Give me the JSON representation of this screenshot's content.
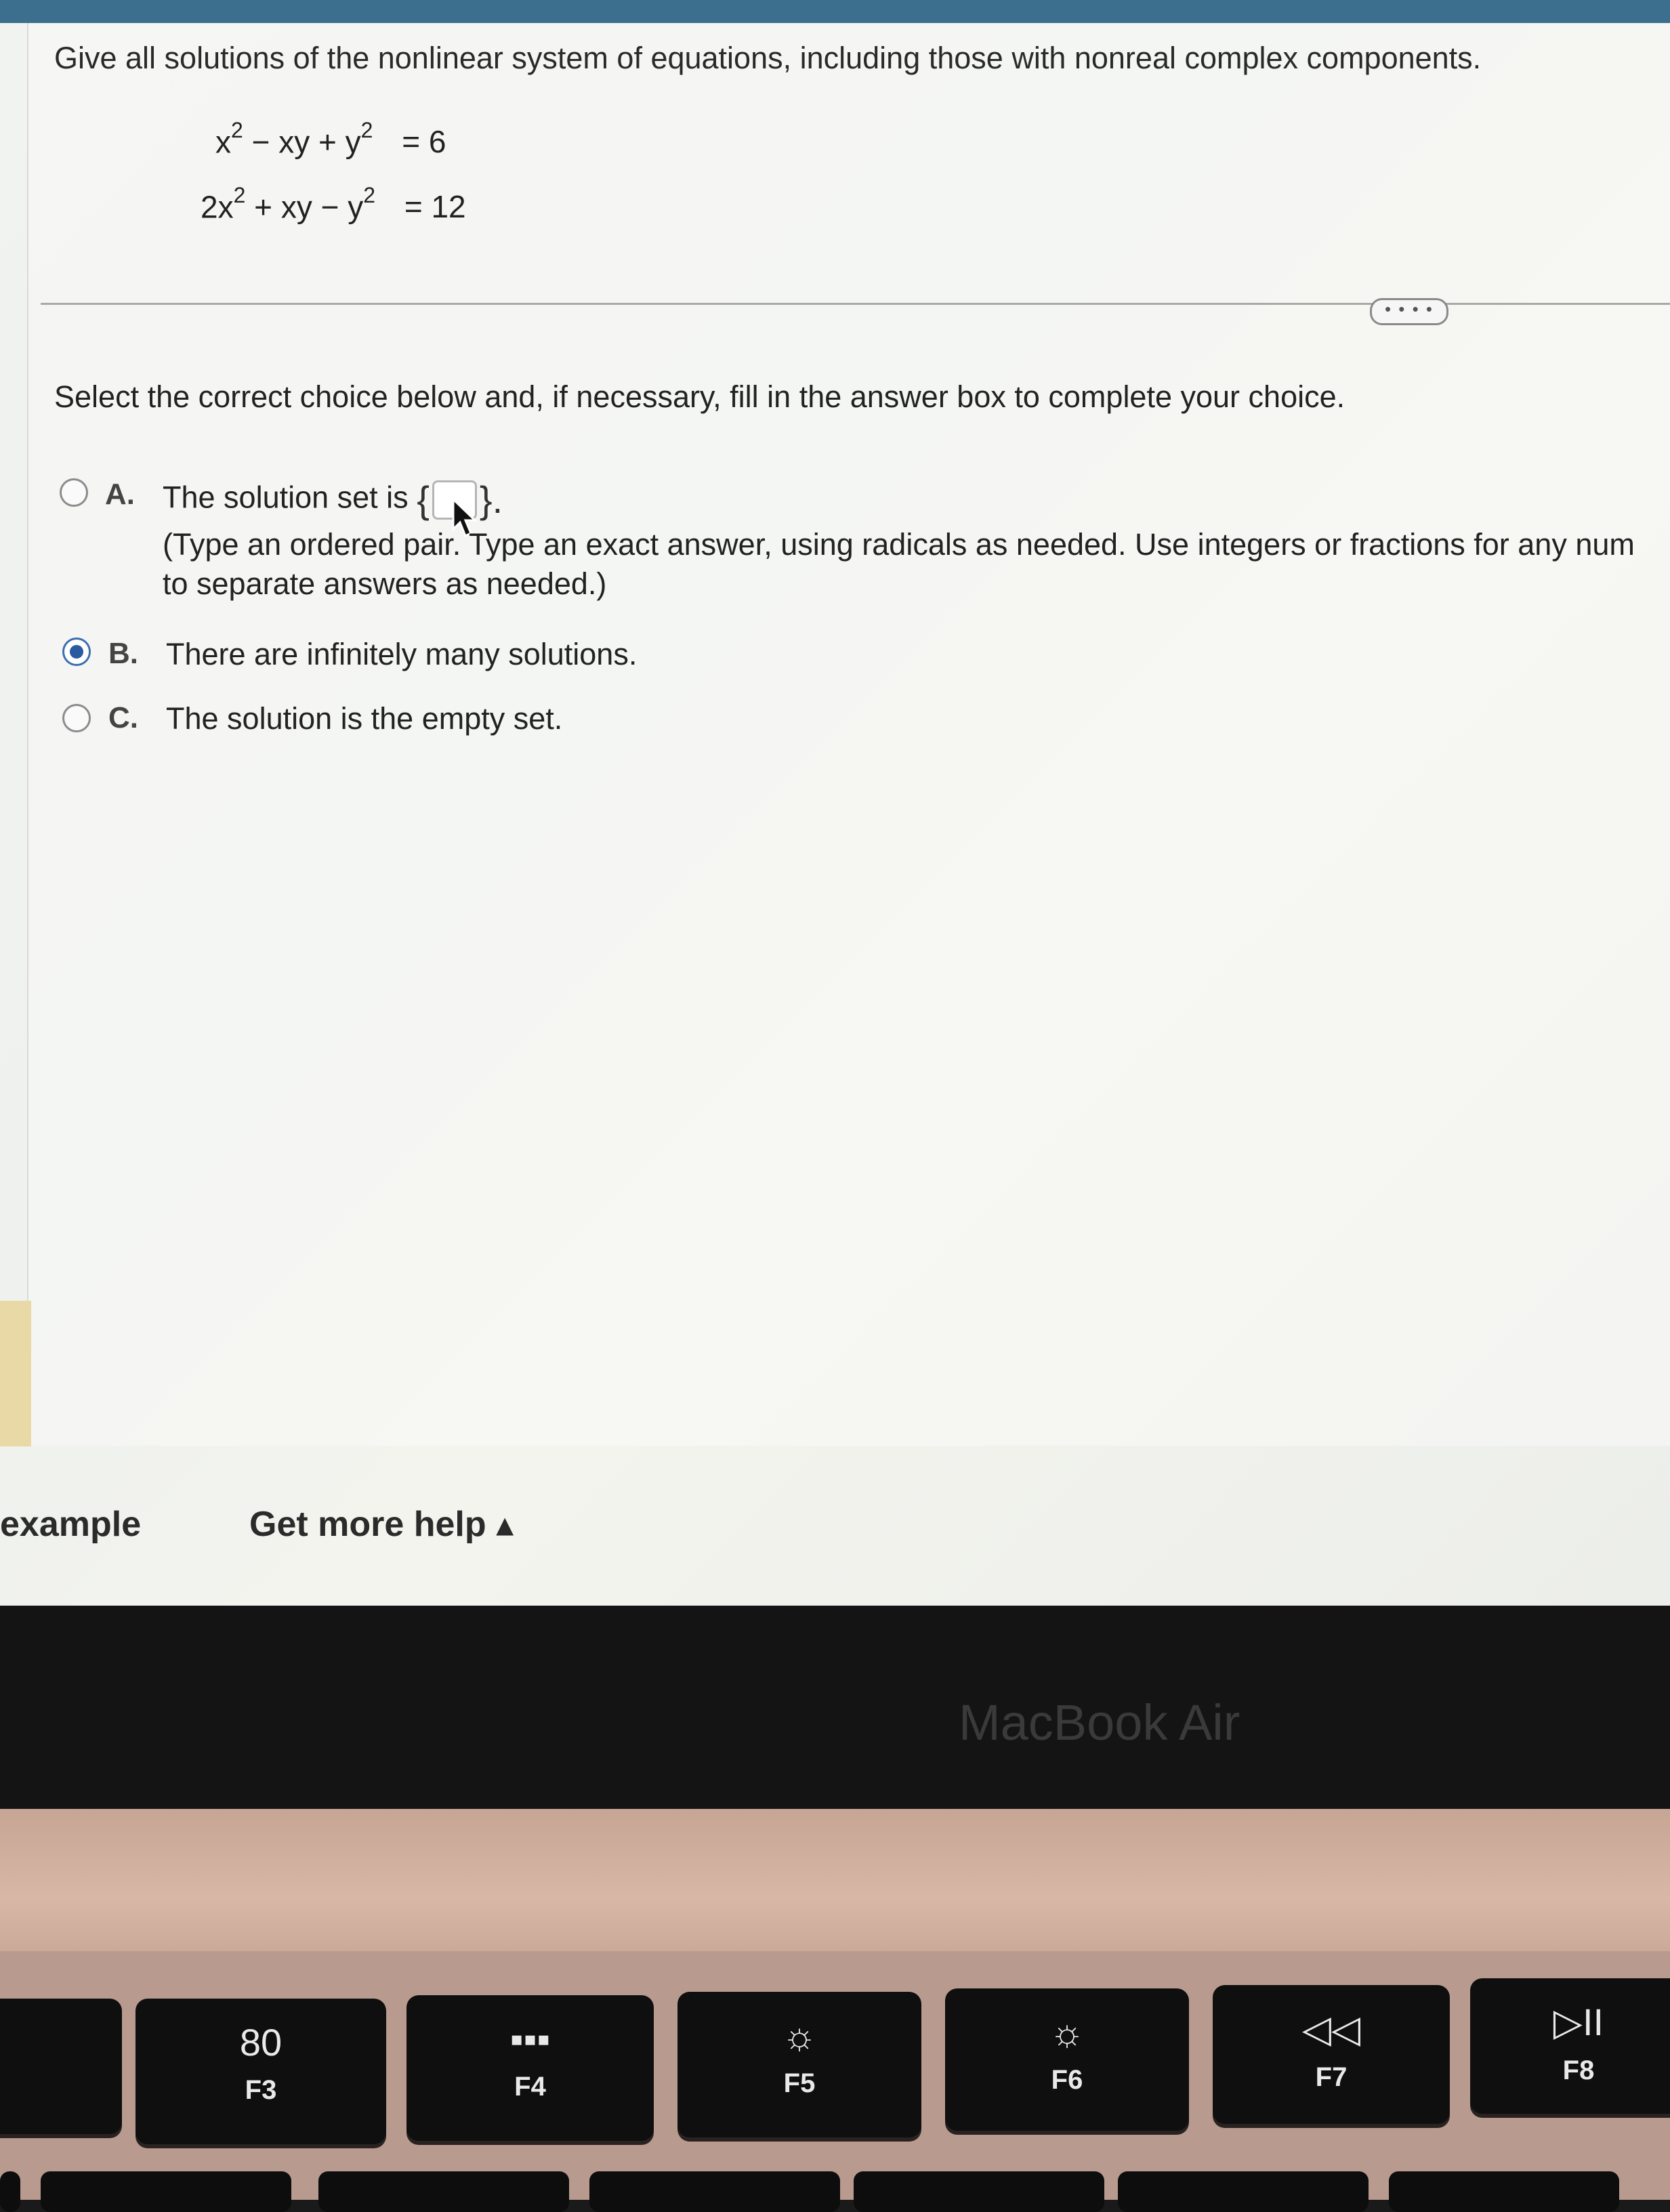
{
  "question": {
    "prompt": "Give all solutions of the nonlinear system of equations, including those with nonreal complex components.",
    "equations": [
      {
        "lhs_parts": [
          "x",
          "2",
          " − xy + y",
          "2"
        ],
        "rhs": "= 6"
      },
      {
        "lhs_parts": [
          "2x",
          "2",
          " + xy − y",
          "2"
        ],
        "rhs": "= 12"
      }
    ]
  },
  "more_button": "• • • •",
  "instruction": "Select the correct choice below and, if necessary, fill in the answer box to complete your choice.",
  "choices": [
    {
      "letter": "A.",
      "text_before": "The solution set is",
      "brace_open": "{",
      "brace_close": "}.",
      "hint_line1": "(Type an ordered pair. Type an exact answer, using radicals as needed. Use integers or fractions for any num",
      "hint_line2": "to separate answers as needed.)",
      "selected": false
    },
    {
      "letter": "B.",
      "text": "There are infinitely many solutions.",
      "selected": true
    },
    {
      "letter": "C.",
      "text": "The solution is the empty set.",
      "selected": false
    }
  ],
  "footer": {
    "example_label": "example",
    "help_label": "Get more help ▴"
  },
  "laptop": {
    "brand": "MacBook Air",
    "keys": [
      {
        "glyph": "80",
        "fn": "F3"
      },
      {
        "glyph": "▪▪▪",
        "fn": "F4"
      },
      {
        "glyph": "☼",
        "fn": "F5"
      },
      {
        "glyph": "☼",
        "fn": "F6"
      },
      {
        "glyph": "◁◁",
        "fn": "F7"
      },
      {
        "glyph": "▷II",
        "fn": "F8"
      }
    ]
  }
}
